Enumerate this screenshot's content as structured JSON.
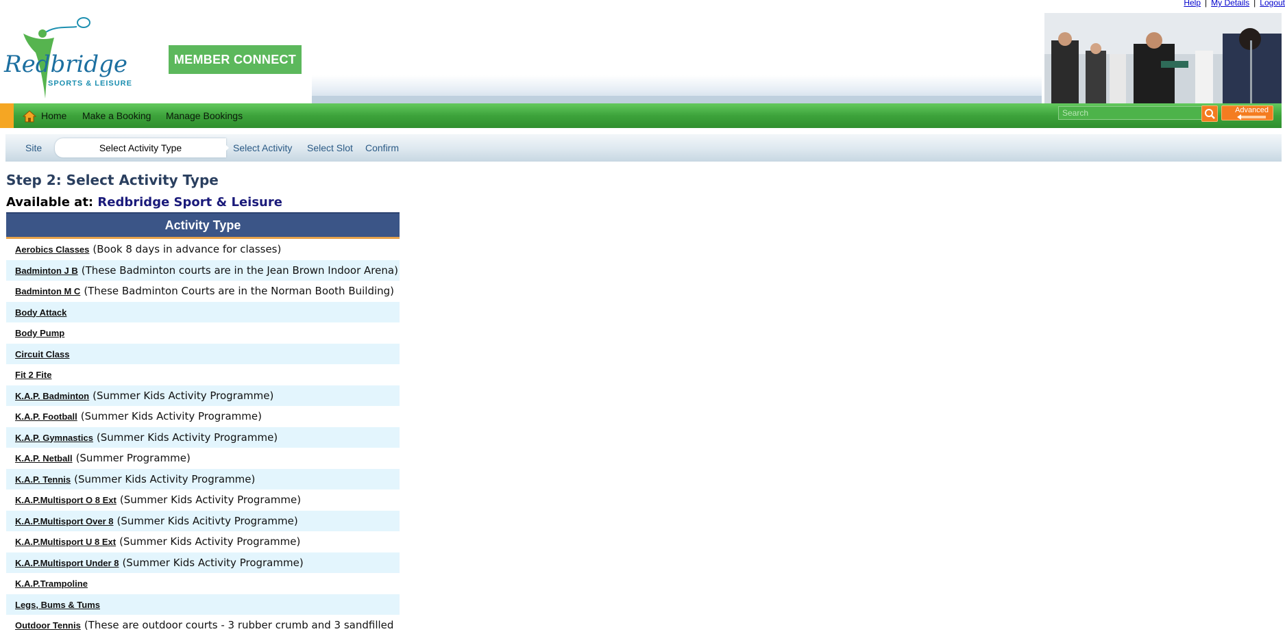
{
  "top_links": [
    "Help",
    "My Details",
    "Logout"
  ],
  "brand": {
    "logo_line1": "Redbridge",
    "logo_line2": "SPORTS & LEISURE",
    "member_connect": "MEMBER CONNECT"
  },
  "nav": {
    "items": [
      "Home",
      "Make a Booking",
      "Manage Bookings"
    ],
    "search_placeholder": "Search",
    "advanced_label": "Advanced"
  },
  "steps": {
    "items": [
      "Site",
      "Select Activity Type",
      "Select Activity",
      "Select Slot",
      "Confirm"
    ],
    "active_index": 1
  },
  "content": {
    "title": "Step 2: Select Activity Type",
    "available_label": "Available at:",
    "site_name": "Redbridge Sport & Leisure",
    "table_header": "Activity Type",
    "rows": [
      {
        "name": "Aerobics Classes",
        "note": "(Book 8 days in advance for classes)"
      },
      {
        "name": "Badminton J B",
        "note": "(These Badminton courts are in the Jean Brown Indoor Arena)"
      },
      {
        "name": "Badminton M C",
        "note": "(These Badminton Courts are in the Norman Booth Building)"
      },
      {
        "name": "Body Attack",
        "note": ""
      },
      {
        "name": "Body Pump",
        "note": ""
      },
      {
        "name": "Circuit Class",
        "note": ""
      },
      {
        "name": "Fit 2 Fite",
        "note": ""
      },
      {
        "name": "K.A.P. Badminton",
        "note": "(Summer Kids Activity Programme)"
      },
      {
        "name": "K.A.P. Football",
        "note": "(Summer Kids Activity Programme)"
      },
      {
        "name": "K.A.P. Gymnastics",
        "note": "(Summer Kids Activity Programme)"
      },
      {
        "name": "K.A.P. Netball",
        "note": "(Summer Programme)"
      },
      {
        "name": "K.A.P. Tennis",
        "note": "(Summer Kids Activity Programme)"
      },
      {
        "name": "K.A.P.Multisport O 8 Ext",
        "note": "(Summer Kids Activity Programme)"
      },
      {
        "name": "K.A.P.Multisport Over 8",
        "note": "(Summer Kids Acitivty Programme)"
      },
      {
        "name": "K.A.P.Multisport U 8 Ext",
        "note": "(Summer Kids Activity Programme)"
      },
      {
        "name": "K.A.P.Multisport Under 8",
        "note": "(Summer Kids Activity Programme)"
      },
      {
        "name": "K.A.P.Trampoline",
        "note": ""
      },
      {
        "name": "Legs, Bums & Tums",
        "note": ""
      },
      {
        "name": "Outdoor Tennis",
        "note": "(These are outdoor courts - 3 rubber crumb and 3 sandfilled"
      }
    ]
  },
  "colors": {
    "nav_green": "#3da33b",
    "accent_orange": "#f47c20",
    "header_blue": "#3b5587",
    "row_alt": "#e3f5fd",
    "member_connect_green": "#5cb85c"
  }
}
